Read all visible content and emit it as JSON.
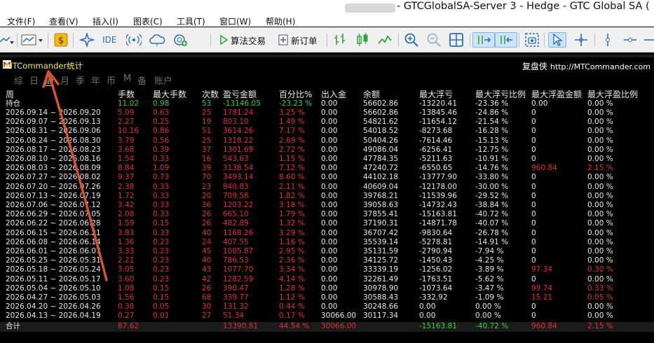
{
  "window": {
    "title": "- GTCGlobalSA-Server 3 - Hedge - GTC Global SA ("
  },
  "menu": [
    "文件(F)",
    "查看(V)",
    "插入(I)",
    "图表(C)",
    "工具(T)",
    "窗口(W)",
    "帮助(H)"
  ],
  "toolbar": {
    "ide_label": "IDE",
    "algo_label": "算法交易",
    "new_order_label": "新订单"
  },
  "panel": {
    "title": "MTCommander统计",
    "brand": "复盘侠",
    "url": "http://MTCommander.com",
    "tabs": [
      "综",
      "日",
      "周",
      "月",
      "季",
      "年",
      "币",
      "M",
      "备",
      "账户"
    ],
    "active_tab": "周"
  },
  "table": {
    "headers": [
      "周",
      "手数",
      "最大手数",
      "次数",
      "盈亏金额",
      "百分比%",
      "出入金",
      "余额",
      "最大浮亏",
      "最大浮亏比例",
      "最大浮盈金额",
      "最大浮盈比例"
    ],
    "holding": [
      "持仓",
      "11.02",
      "0.98",
      "53",
      "-13146.05",
      "-23.23 %",
      "0.00",
      "56602.86",
      "-13220.41",
      "-23.36 %",
      "0.00",
      "0.00 %"
    ],
    "rows": [
      [
        "2026.09.14 ~ 2026.09.20",
        "5.09",
        "0.63",
        "25",
        "1781.24",
        "3.25 %",
        "0.00",
        "56602.86",
        "-13845.46",
        "-24.86 %",
        "0",
        "0.00 %"
      ],
      [
        "2026.09.07 ~ 2026.09.13",
        "2.27",
        "0.25",
        "19",
        "803.10",
        "1.49 %",
        "0.00",
        "54821.62",
        "-11654.12",
        "-21.54 %",
        "0",
        "0.00 %"
      ],
      [
        "2026.08.31 ~ 2026.09.06",
        "10.16",
        "0.86",
        "51",
        "3614.26",
        "7.17 %",
        "0.00",
        "54018.52",
        "-8273.68",
        "-16.28 %",
        "0",
        "0.00 %"
      ],
      [
        "2026.08.24 ~ 2026.08.30",
        "3.79",
        "0.56",
        "25",
        "1318.22",
        "2.69 %",
        "0.00",
        "50404.26",
        "-7614.46",
        "-15.13 %",
        "0",
        "0.00 %"
      ],
      [
        "2026.08.17 ~ 2026.08.23",
        "3.68",
        "0.39",
        "37",
        "1301.69",
        "2.72 %",
        "0.00",
        "49086.04",
        "-6256.41",
        "-12.75 %",
        "0",
        "0.00 %"
      ],
      [
        "2026.08.10 ~ 2026.08.16",
        "1.54",
        "0.33",
        "16",
        "543.63",
        "1.15 %",
        "0.00",
        "47784.35",
        "-5211.63",
        "-10.91 %",
        "0",
        "0.00 %"
      ],
      [
        "2026.08.03 ~ 2026.08.09",
        "8.84",
        "1.09",
        "39",
        "3138.54",
        "7.12 %",
        "0.00",
        "47240.72",
        "-6550.65",
        "-14.76 %",
        "960.84",
        "2.15 %"
      ],
      [
        "2026.07.27 ~ 2026.08.02",
        "9.37",
        "0.73",
        "70",
        "3493.14",
        "8.60 %",
        "0.00",
        "44102.18",
        "-13777.90",
        "-33.80 %",
        "0",
        "0.00 %"
      ],
      [
        "2026.07.20 ~ 2026.07.26",
        "2.38",
        "0.33",
        "23",
        "840.83",
        "2.11 %",
        "0.00",
        "40609.04",
        "-12178.00",
        "-30.00 %",
        "0",
        "0.00 %"
      ],
      [
        "2026.07.13 ~ 2026.07.19",
        "1.72",
        "0.33",
        "20",
        "709.58",
        "1.82 %",
        "0.00",
        "39768.21",
        "-11539.96",
        "-29.52 %",
        "0",
        "0.00 %"
      ],
      [
        "2026.07.06 ~ 2026.07.12",
        "3.42",
        "0.33",
        "36",
        "1203.22",
        "3.18 %",
        "0.00",
        "39058.63",
        "-14732.43",
        "-38.84 %",
        "0",
        "0.00 %"
      ],
      [
        "2026.06.29 ~ 2026.07.05",
        "2.08",
        "0.33",
        "26",
        "665.10",
        "1.79 %",
        "0.00",
        "37855.41",
        "-15163.81",
        "-40.72 %",
        "0",
        "0.00 %"
      ],
      [
        "2026.06.22 ~ 2026.06.28",
        "1.59",
        "0.15",
        "26",
        "482.89",
        "1.32 %",
        "0.00",
        "37190.31",
        "-14871.78",
        "-40.07 %",
        "0",
        "0.00 %"
      ],
      [
        "2026.06.15 ~ 2026.06.21",
        "3.83",
        "0.33",
        "40",
        "1168.26",
        "3.29 %",
        "0.00",
        "36707.42",
        "-9830.64",
        "-26.78 %",
        "0",
        "0.00 %"
      ],
      [
        "2026.06.08 ~ 2026.06.14",
        "1.36",
        "0.23",
        "24",
        "407.55",
        "1.16 %",
        "0.00",
        "35539.14",
        "-5278.81",
        "-14.91 %",
        "0",
        "0.00 %"
      ],
      [
        "2026.06.01 ~ 2026.06.07",
        "3.33",
        "0.23",
        "45",
        "1005.87",
        "2.95 %",
        "0.00",
        "35131.59",
        "-2790.94",
        "-7.94 %",
        "0",
        "0.00 %"
      ],
      [
        "2026.05.25 ~ 2026.05.31",
        "2.21",
        "0.23",
        "40",
        "786.53",
        "2.36 %",
        "0.00",
        "34125.72",
        "-1450.43",
        "-4.25 %",
        "0",
        "0.00 %"
      ],
      [
        "2026.05.18 ~ 2026.05.24",
        "3.05",
        "0.23",
        "43",
        "1077.70",
        "3.34 %",
        "0.00",
        "33339.19",
        "-1256.02",
        "-3.89 %",
        "97.34",
        "0.30 %"
      ],
      [
        "2026.05.11 ~ 2026.05.17",
        "3.60",
        "0.23",
        "42",
        "1282.59",
        "4.14 %",
        "0.00",
        "32261.49",
        "-1763.51",
        "-5.62 %",
        "0",
        "0.00 %"
      ],
      [
        "2026.05.04 ~ 2026.05.10",
        "1.08",
        "0.15",
        "26",
        "390.47",
        "1.28 %",
        "0.00",
        "30978.90",
        "-1073.64",
        "-3.47 %",
        "99.74",
        "0.33 %"
      ],
      [
        "2026.04.27 ~ 2026.05.03",
        "1.56",
        "0.15",
        "68",
        "339.77",
        "1.12 %",
        "0.00",
        "30588.43",
        "-332.92",
        "-1.09 %",
        "15.21",
        "0.05 %"
      ],
      [
        "2026.04.20 ~ 2026.04.26",
        "0.38",
        "0.05",
        "30",
        "131.32",
        "0.44 %",
        "0.00",
        "30248.66",
        "0.00",
        "0.00 %",
        "0",
        "0.00 %"
      ],
      [
        "2026.04.13 ~ 2026.04.19",
        "0.27",
        "0.01",
        "27",
        "51.34",
        "0.17 %",
        "30066.00",
        "30117.34",
        "0.00",
        "0.00 %",
        "0",
        "0.00 %"
      ]
    ],
    "total": [
      "合计",
      "87.62",
      "",
      "",
      "13390.81",
      "44.54 %",
      "30066.00",
      "",
      "-15163.81",
      "-40.72 %",
      "960.84",
      "2.15 %"
    ]
  }
}
